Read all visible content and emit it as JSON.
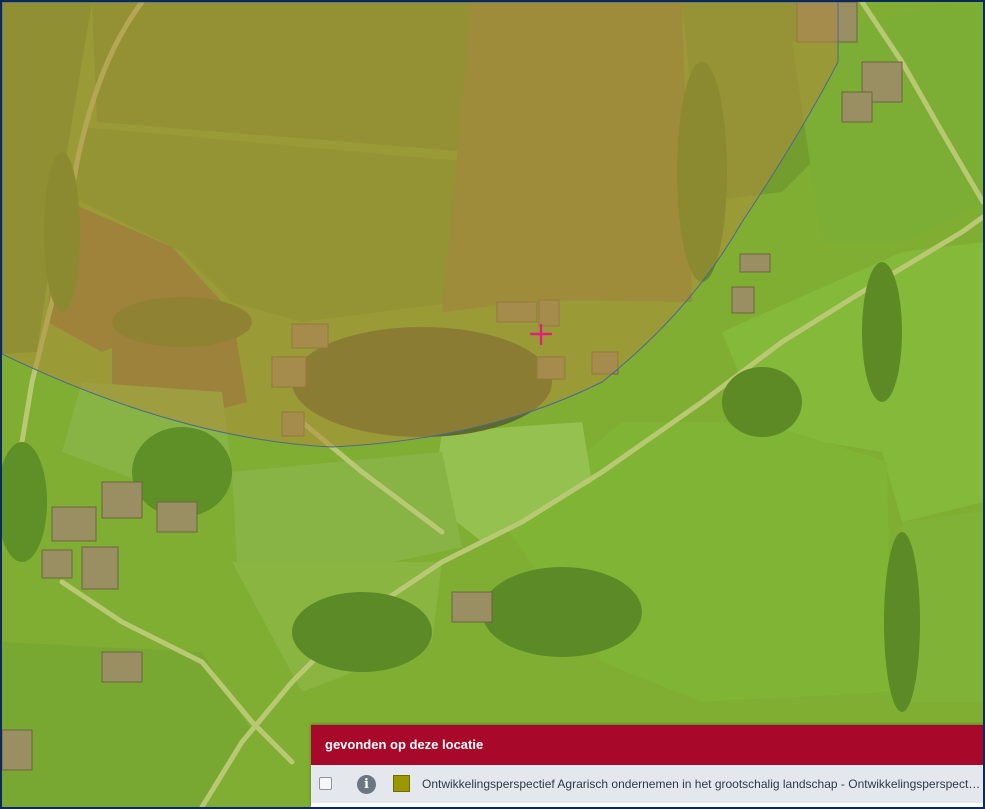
{
  "panel": {
    "title": "gevonden op deze locatie",
    "results": [
      {
        "label": "Ontwikkelingsperspectief Agrarisch ondernemen in het grootschalig landschap - Ontwikkelingsperspectief Agrarisch ondernemen in het grootschalig landschap",
        "swatch_color": "#9b9700",
        "checked": false
      }
    ]
  },
  "map": {
    "highlight_color": "#b08a3a",
    "base_color": "#7fae33",
    "marker_color": "#e0207a",
    "icons": [
      "crosshair-marker-icon",
      "info-icon",
      "checkbox-icon"
    ]
  }
}
